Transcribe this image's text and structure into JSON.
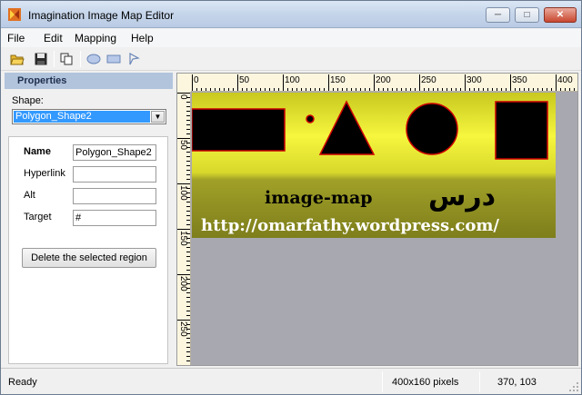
{
  "window": {
    "title": "Imagination Image Map Editor",
    "controls": {
      "minimize": "─",
      "maximize": "□",
      "close": "✕"
    }
  },
  "menu": [
    "File",
    "Edit",
    "Mapping",
    "Help"
  ],
  "toolbar": {
    "icons": [
      "open-folder-icon",
      "save-icon",
      "copy-icon",
      "ellipse-tool-icon",
      "rectangle-tool-icon",
      "polygon-tool-icon"
    ]
  },
  "properties": {
    "header": "Properties",
    "shape_label": "Shape:",
    "shape_selected": "Polygon_Shape2",
    "fields": {
      "name_label": "Name",
      "name_value": "Polygon_Shape2",
      "hyperlink_label": "Hyperlink",
      "hyperlink_value": "",
      "alt_label": "Alt",
      "alt_value": "",
      "target_label": "Target",
      "target_value": "#"
    },
    "delete_button": "Delete the selected region"
  },
  "ruler": {
    "horizontal": [
      "0",
      "50",
      "100",
      "150",
      "200",
      "250",
      "300",
      "350",
      "400"
    ],
    "vertical": [
      "0",
      "50",
      "100",
      "150",
      "200",
      "250"
    ]
  },
  "image": {
    "arabic_text": "درس",
    "title_text": "image-map",
    "url_text": "http://omarfathy.wordpress.com/",
    "colors": {
      "top": "#f4f43a",
      "bottom": "#8a8a22",
      "shape_fill": "#000000",
      "shape_border": "#cc0000"
    }
  },
  "status": {
    "text": "Ready",
    "image_size": "400x160 pixels",
    "cursor": "370, 103"
  }
}
